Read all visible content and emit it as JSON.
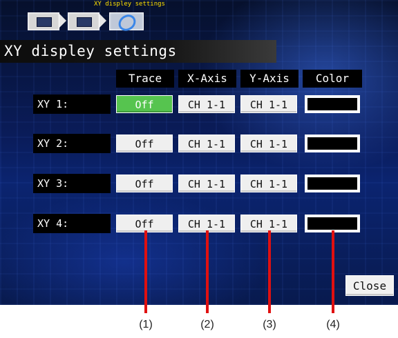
{
  "breadcrumb": {
    "current_label": "XY displey settings",
    "items": [
      {
        "icon": "monitor-icon"
      },
      {
        "icon": "settings-screen-icon"
      },
      {
        "icon": "xy-ring-icon"
      }
    ]
  },
  "page_title": "XY displey settings",
  "columns": {
    "trace": "Trace",
    "x_axis": "X-Axis",
    "y_axis": "Y-Axis",
    "color": "Color"
  },
  "rows": [
    {
      "label": "XY 1:",
      "trace": "Off",
      "x_axis": "CH 1-1",
      "y_axis": "CH 1-1",
      "color": "#000000",
      "trace_highlighted": true
    },
    {
      "label": "XY 2:",
      "trace": "Off",
      "x_axis": "CH 1-1",
      "y_axis": "CH 1-1",
      "color": "#000000"
    },
    {
      "label": "XY 3:",
      "trace": "Off",
      "x_axis": "CH 1-1",
      "y_axis": "CH 1-1",
      "color": "#000000"
    },
    {
      "label": "XY 4:",
      "trace": "Off",
      "x_axis": "CH 1-1",
      "y_axis": "CH 1-1",
      "color": "#000000"
    }
  ],
  "close_label": "Close",
  "callouts": [
    "(1)",
    "(2)",
    "(3)",
    "(4)"
  ],
  "colors": {
    "active_button": "#56c44f",
    "callout_line": "#e01010",
    "breadcrumb_title": "#ffe000"
  }
}
